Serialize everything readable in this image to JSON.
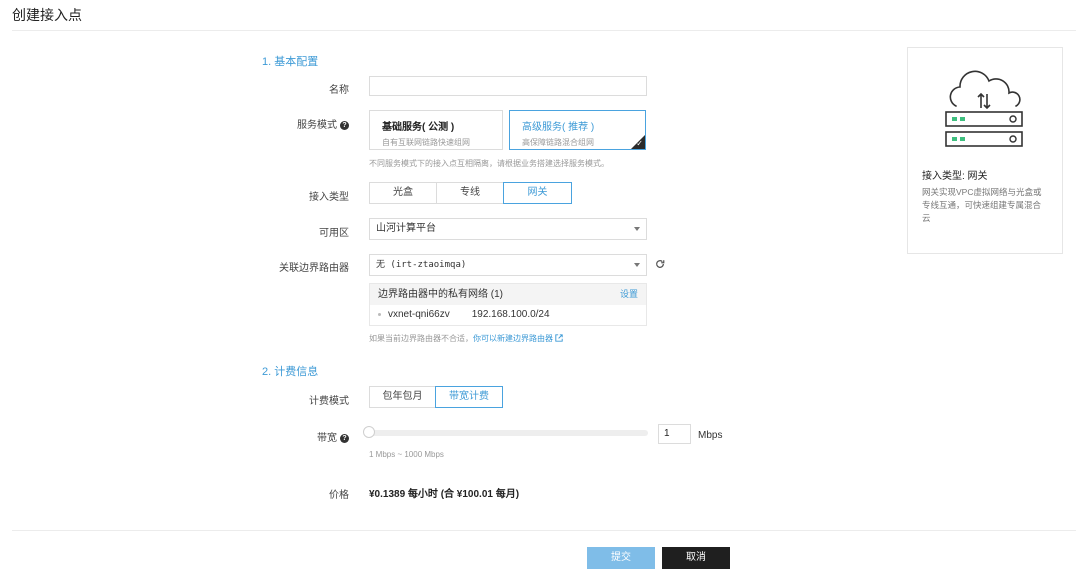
{
  "page_title": "创建接入点",
  "section1": {
    "title": "1. 基本配置"
  },
  "name_field": {
    "label": "名称",
    "value": "",
    "placeholder": ""
  },
  "service_mode": {
    "label": "服务模式",
    "options": [
      {
        "title": "基础服务( 公测 )",
        "desc": "自有互联网链路快速组网"
      },
      {
        "title": "高级服务( 推荐 )",
        "desc": "高保障链路混合组网"
      }
    ],
    "selected_index": 1,
    "hint": "不同服务模式下的接入点互相隔离，请根据业务搭建选择服务模式。"
  },
  "access_type": {
    "label": "接入类型",
    "options": [
      "光盒",
      "专线",
      "网关"
    ],
    "selected_index": 2
  },
  "availability_zone": {
    "label": "可用区",
    "value": "山河计算平台"
  },
  "border_router": {
    "label": "关联边界路由器",
    "value": "无 (irt-ztaoimqa)",
    "networks_title": "边界路由器中的私有网络 (1)",
    "settings_link": "设置",
    "networks": [
      {
        "id": "vxnet-qni66zv",
        "cidr": "192.168.100.0/24"
      }
    ],
    "hint_prefix": "如果当前边界路由器不合适，",
    "hint_link": "你可以新建边界路由器"
  },
  "section2": {
    "title": "2. 计费信息"
  },
  "billing_mode": {
    "label": "计费模式",
    "options": [
      "包年包月",
      "带宽计费"
    ],
    "selected_index": 1
  },
  "bandwidth": {
    "label": "带宽",
    "value": "1",
    "unit": "Mbps",
    "range_hint": "1 Mbps ~ 1000 Mbps",
    "min": 1,
    "max": 1000,
    "current": 1
  },
  "price": {
    "label": "价格",
    "value": "¥0.1389 每小时 (合 ¥100.01 每月)"
  },
  "footer": {
    "submit_label": "提交",
    "cancel_label": "取消"
  },
  "side_panel": {
    "title": "接入类型: 网关",
    "description": "网关实现VPC虚拟网络与光盒或专线互通，可快速组建专属混合云"
  },
  "colors": {
    "accent": "#3d9ad6",
    "primary_button": "#7fbde8",
    "dark_button": "#1f1f1f",
    "server_light": "#3fbf7f"
  },
  "icons": {
    "side_panel": "cloud-server-icon",
    "refresh": "refresh-icon",
    "help": "help-icon",
    "check": "check-icon"
  }
}
